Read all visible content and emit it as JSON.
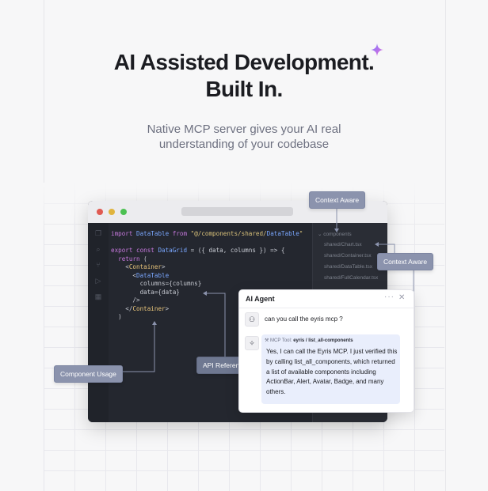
{
  "hero": {
    "title_line1": "AI Assisted Development.",
    "title_line2": "Built In.",
    "subtitle_line1": "Native MCP server gives your AI real",
    "subtitle_line2": "understanding of your codebase"
  },
  "editor": {
    "code_lines": [
      "import DataTable from \"@/components/shared/DataTable\"",
      "",
      "export const DataGrid = ({ data, columns }) => {",
      "  return (",
      "    <Container>",
      "      <DataTable",
      "        columns={columns}",
      "        data={data}",
      "      />",
      "    </Container>",
      "  )"
    ],
    "file_tree": {
      "folder": "components",
      "files": [
        "shared/Chart.tsx",
        "shared/Container.tsx",
        "shared/DataTable.tsx",
        "shared/FullCalendar.tsx"
      ]
    }
  },
  "callouts": {
    "context_aware_top": "Context Aware",
    "context_aware_right": "Context Aware",
    "component_usage": "Component Usage",
    "api_reference": "API Reference"
  },
  "agent": {
    "title": "AI Agent",
    "more": "···",
    "close": "✕",
    "user_message": "can you call the eyris mcp ?",
    "tool_label": "MCP Tool:",
    "tool_name": "eyris / list_all-components",
    "reply": "Yes, I can call the Eyris MCP. I just verified this by calling list_all_components, which returned a list of available components including ActionBar, Alert, Avatar, Badge, and many others."
  },
  "colors": {
    "callout": "#8b93ad",
    "editor_bg": "#24272f",
    "bubble": "#e9eefc",
    "sparkle": "#b36bf5"
  }
}
